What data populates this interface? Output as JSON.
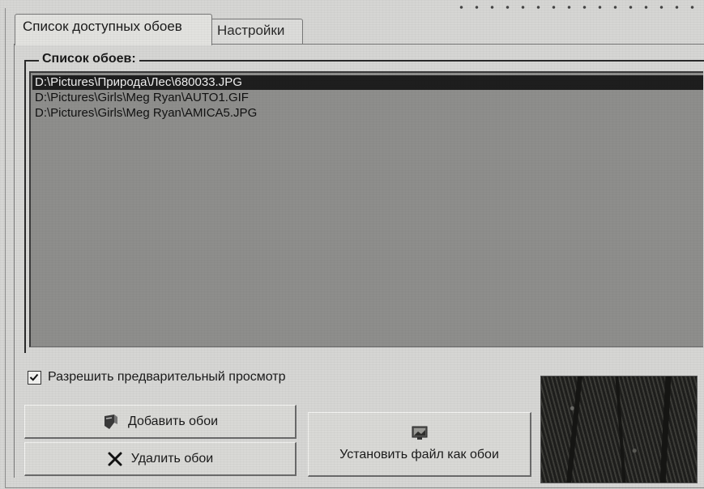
{
  "window": {
    "tabs": [
      {
        "label": "Список доступных обоев",
        "active": true
      },
      {
        "label": "Настройки",
        "active": false
      }
    ]
  },
  "wallpaper_list": {
    "group_label": "Список обоев:",
    "items": [
      {
        "path": "D:\\Pictures\\Природа\\Лес\\680033.JPG",
        "selected": true
      },
      {
        "path": "D:\\Pictures\\Girls\\Meg Ryan\\AUTO1.GIF",
        "selected": false
      },
      {
        "path": "D:\\Pictures\\Girls\\Meg Ryan\\AMICA5.JPG",
        "selected": false
      }
    ]
  },
  "preview": {
    "checkbox_label": "Разрешить предварительный просмотр",
    "checked": true
  },
  "buttons": {
    "add_label": "Добавить обои",
    "delete_label": "Удалить обои",
    "set_label": "Установить файл как обои"
  },
  "colors": {
    "list_background": "#8e8e8c",
    "selection": "#1e1e1e",
    "window_background": "#d6d6d4"
  },
  "icons": {
    "add": "add-wallpaper-icon",
    "delete": "delete-x-icon",
    "set": "set-wallpaper-icon",
    "check": "checkmark-icon"
  }
}
